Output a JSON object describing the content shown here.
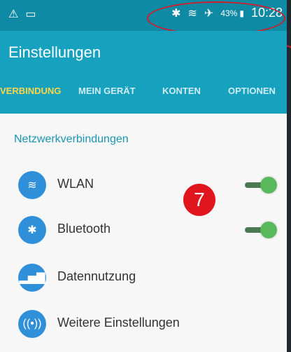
{
  "status_bar": {
    "battery_percent": "43%",
    "time": "10:28",
    "icons": [
      "alert-icon",
      "screen-icon",
      "bluetooth-icon",
      "wifi-icon",
      "airplane-icon",
      "battery-icon"
    ]
  },
  "appbar": {
    "title": "Einstellungen"
  },
  "tabs": [
    {
      "label": "VERBINDUNG",
      "active": true
    },
    {
      "label": "MEIN GERÄT",
      "active": false
    },
    {
      "label": "KONTEN",
      "active": false
    },
    {
      "label": "OPTIONEN",
      "active": false
    }
  ],
  "content": {
    "section_title": "Netzwerkverbindungen",
    "items": [
      {
        "label": "WLAN",
        "icon": "wifi-icon",
        "toggle": true
      },
      {
        "label": "Bluetooth",
        "icon": "bluetooth-icon",
        "toggle": true
      },
      {
        "label": "Datennutzung",
        "icon": "data-usage-icon",
        "toggle": false
      },
      {
        "label": "Weitere Einstellungen",
        "icon": "more-settings-icon",
        "toggle": false
      }
    ]
  },
  "callout": {
    "number": "7"
  },
  "colors": {
    "statusbar": "#0f8aa5",
    "appbar": "#16a2bf",
    "accent": "#ffd54a",
    "section": "#1a95b0",
    "badge": "#e1151e"
  }
}
